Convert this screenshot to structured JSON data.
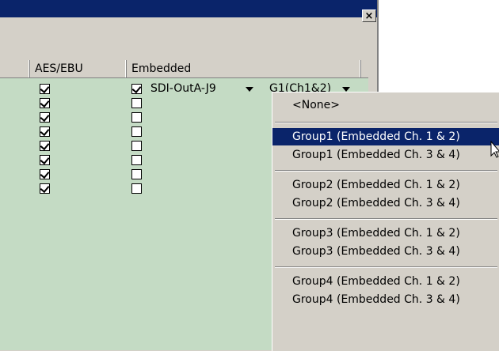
{
  "window": {
    "close_label": "×"
  },
  "table": {
    "columns": [
      "AES/EBU",
      "Embedded"
    ],
    "aes_checks": [
      true,
      true,
      true,
      true,
      true,
      true,
      true,
      true
    ],
    "embedded_checks": [
      true,
      false,
      false,
      false,
      false,
      false,
      false,
      false
    ],
    "row0": {
      "output": "SDI-OutA-J9",
      "group": "G1(Ch1&2)"
    }
  },
  "dropdown_menu": {
    "items": [
      "<None>",
      "Group1 (Embedded Ch. 1 & 2)",
      "Group1 (Embedded Ch. 3 & 4)",
      "Group2 (Embedded Ch. 1 & 2)",
      "Group2 (Embedded Ch. 3 & 4)",
      "Group3 (Embedded Ch. 1 & 2)",
      "Group3 (Embedded Ch. 3 & 4)",
      "Group4 (Embedded Ch. 1 & 2)",
      "Group4 (Embedded Ch. 3 & 4)"
    ],
    "highlighted": "Group1 (Embedded Ch. 1 & 2)"
  },
  "colors": {
    "titlebar": "#0a246a",
    "grid_bg": "#c4dbc4",
    "highlight": "#0a246a"
  }
}
